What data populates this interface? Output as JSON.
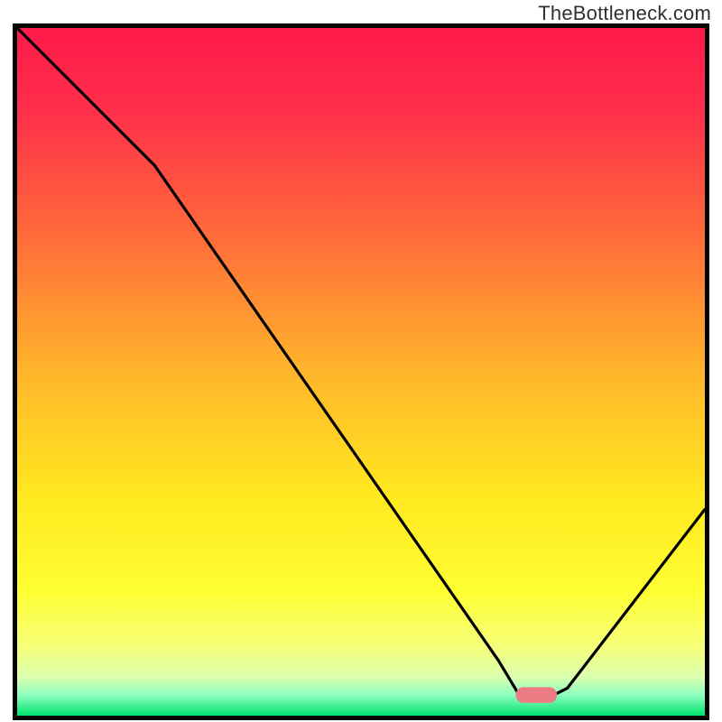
{
  "watermark": {
    "text": "TheBottleneck.com"
  },
  "chart_data": {
    "type": "line",
    "title": "",
    "xlabel": "",
    "ylabel": "",
    "xlim": [
      0,
      100
    ],
    "ylim": [
      0,
      100
    ],
    "grid": false,
    "legend": false,
    "gradient_stops": [
      {
        "offset": 0.0,
        "color": "#ff1a4a"
      },
      {
        "offset": 0.12,
        "color": "#ff2f4b"
      },
      {
        "offset": 0.3,
        "color": "#ff6a3a"
      },
      {
        "offset": 0.5,
        "color": "#ffb52b"
      },
      {
        "offset": 0.68,
        "color": "#ffe81f"
      },
      {
        "offset": 0.82,
        "color": "#ffff33"
      },
      {
        "offset": 0.9,
        "color": "#f6ff7a"
      },
      {
        "offset": 0.945,
        "color": "#d9ffb0"
      },
      {
        "offset": 0.97,
        "color": "#8cffbe"
      },
      {
        "offset": 1.0,
        "color": "#00e36d"
      }
    ],
    "series": [
      {
        "name": "bottleneck-curve",
        "x": [
          0,
          20,
          70,
          73,
          78,
          80,
          100
        ],
        "y": [
          100,
          80,
          8,
          3,
          3,
          4,
          30
        ]
      }
    ],
    "marker": {
      "name": "optimal-range",
      "shape": "rounded-bar",
      "color": "#ed7b84",
      "x_center": 75.5,
      "y_center": 3,
      "width_x_units": 6,
      "height_y_units": 2.3
    }
  }
}
